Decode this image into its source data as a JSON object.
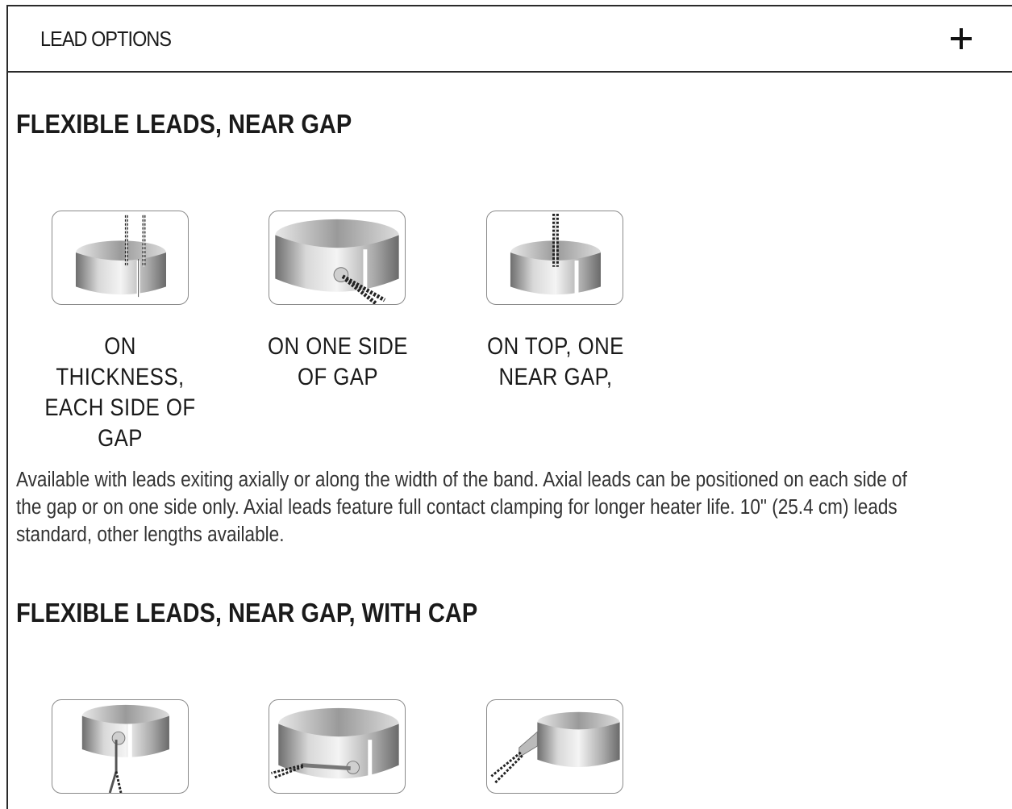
{
  "accordion": {
    "title": "LEAD OPTIONS",
    "toggle_icon": "plus-icon"
  },
  "section1": {
    "heading": "FLEXIBLE LEADS, NEAR GAP",
    "options": [
      {
        "caption": "ON THICKNESS, EACH SIDE OF GAP"
      },
      {
        "caption": "ON ONE SIDE OF GAP"
      },
      {
        "caption": "ON TOP, ONE NEAR GAP,"
      }
    ],
    "description": "Available with leads exiting axially or along the width of the band. Axial leads can be positioned on each side of the gap or on one side only. Axial leads feature full contact clamping for longer heater life. 10\" (25.4 cm) leads standard, other lengths available."
  },
  "section2": {
    "heading": "FLEXIBLE LEADS, NEAR GAP, WITH CAP"
  },
  "colors": {
    "border": "#2a2a2a",
    "thumb_border": "#8a8a8a",
    "text": "#1a1a1a"
  }
}
